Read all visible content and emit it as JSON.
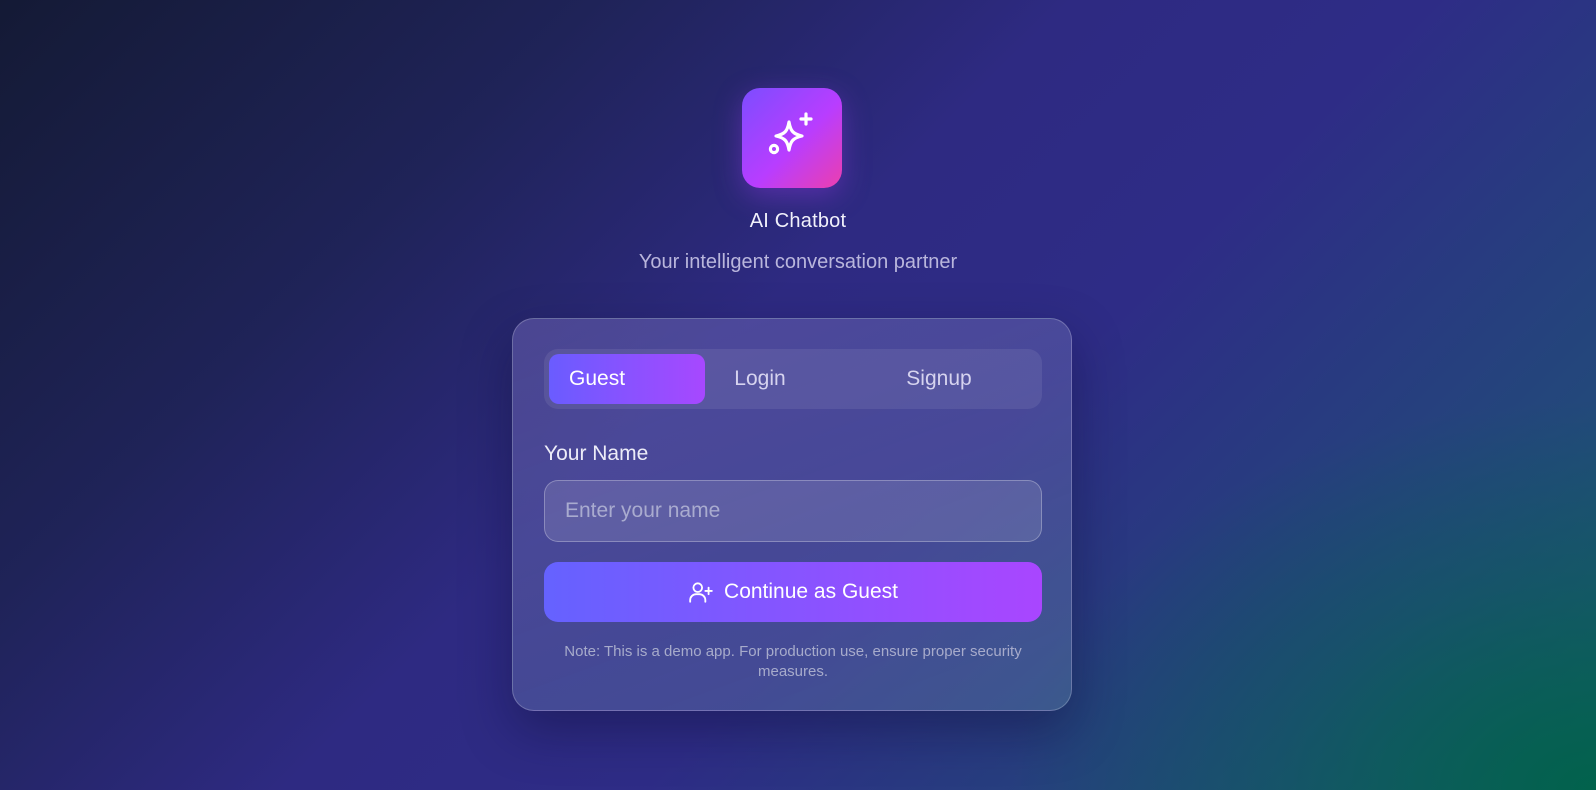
{
  "app": {
    "logo_icon": "sparkles-icon",
    "title": "AI Chatbot",
    "subtitle": "Your intelligent conversation partner"
  },
  "auth_card": {
    "tabs": [
      {
        "label": "Guest",
        "active": true
      },
      {
        "label": "Login",
        "active": false
      },
      {
        "label": "Signup",
        "active": false
      }
    ],
    "name_label": "Your Name",
    "name_placeholder": "Enter your name",
    "name_value": "",
    "continue_button": {
      "label": "Continue as Guest",
      "icon": "user-plus-icon"
    },
    "note": "Note: This is a demo app. For production use, ensure proper security measures."
  },
  "colors": {
    "accent_start": "#6562ff",
    "accent_end": "#a946ff",
    "logo_gradient_end": "#ec3fae"
  }
}
